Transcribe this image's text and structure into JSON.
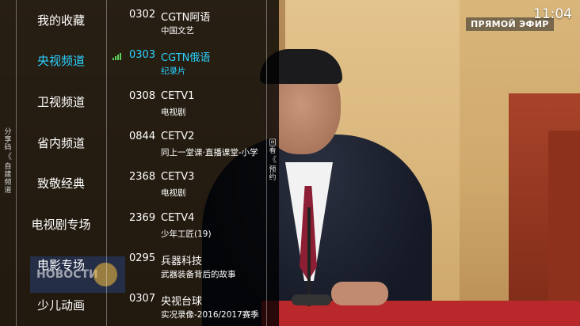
{
  "status": {
    "time": "11:04"
  },
  "watermark": {
    "live": "ПРЯМОЙ ЭФИР",
    "news": "НОВОСТИ"
  },
  "left_tab": {
    "chars": [
      "分",
      "享",
      "码",
      "《",
      "自",
      "建",
      "频",
      "道"
    ]
  },
  "right_tab": {
    "chars": [
      "回",
      "看",
      "《",
      "预",
      "约"
    ]
  },
  "categories": [
    {
      "label": "我的收藏"
    },
    {
      "label": "央视频道",
      "active": true
    },
    {
      "label": "卫视频道"
    },
    {
      "label": "省内频道"
    },
    {
      "label": "致敬经典"
    },
    {
      "label": "电视剧专场"
    },
    {
      "label": "电影专场"
    },
    {
      "label": "少儿动画"
    }
  ],
  "channels": [
    {
      "num": "0302",
      "name": "CGTN阿语",
      "program": "中国文艺"
    },
    {
      "num": "0303",
      "name": "CGTN俄语",
      "program": "纪录片",
      "active": true
    },
    {
      "num": "0308",
      "name": "CETV1",
      "program": "电视剧"
    },
    {
      "num": "0844",
      "name": "CETV2",
      "program": "同上一堂课·直播课堂-小学"
    },
    {
      "num": "2368",
      "name": "CETV3",
      "program": "电视剧"
    },
    {
      "num": "2369",
      "name": "CETV4",
      "program": "少年工匠(19)"
    },
    {
      "num": "0295",
      "name": "兵器科技",
      "program": "武器装备背后的故事"
    },
    {
      "num": "0307",
      "name": "央视台球",
      "program": "实况录像-2016/2017赛季"
    }
  ],
  "colors": {
    "accent": "#2ad1ff",
    "signal": "#5bd15b"
  }
}
